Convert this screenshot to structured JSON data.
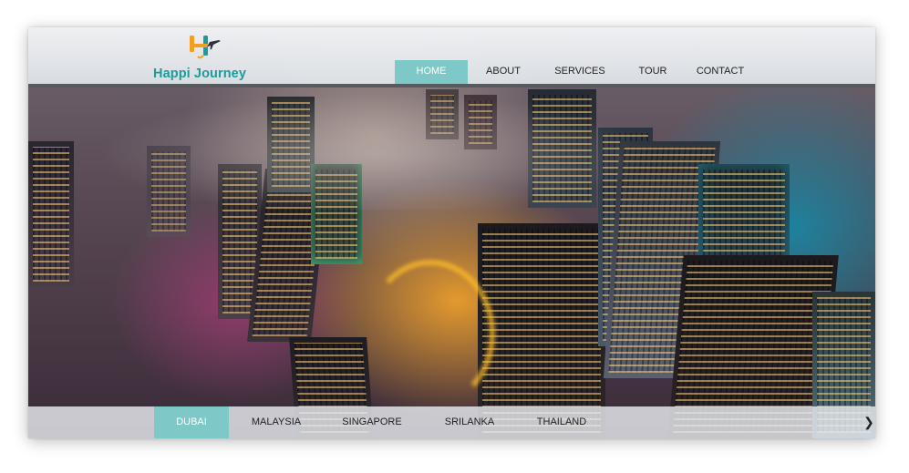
{
  "logo": {
    "text": "Happi Journey"
  },
  "nav": {
    "items": [
      {
        "label": "HOME",
        "active": true
      },
      {
        "label": "ABOUT",
        "active": false
      },
      {
        "label": "SERVICES",
        "active": false
      },
      {
        "label": "TOUR",
        "active": false
      },
      {
        "label": "CONTACT",
        "active": false
      }
    ]
  },
  "hero": {
    "description_icon": "city-skyline-photo"
  },
  "tabs": {
    "items": [
      {
        "label": "DUBAI",
        "active": true
      },
      {
        "label": "MALAYSIA",
        "active": false
      },
      {
        "label": "SINGAPORE",
        "active": false
      },
      {
        "label": "SRILANKA",
        "active": false
      },
      {
        "label": "THAILAND",
        "active": false
      }
    ],
    "next_icon": "chevron-right-icon"
  },
  "colors": {
    "accent": "#7fc8c8",
    "logo_teal": "#1d9b9b",
    "logo_orange": "#f0a020",
    "header_rule": "#565b60"
  }
}
